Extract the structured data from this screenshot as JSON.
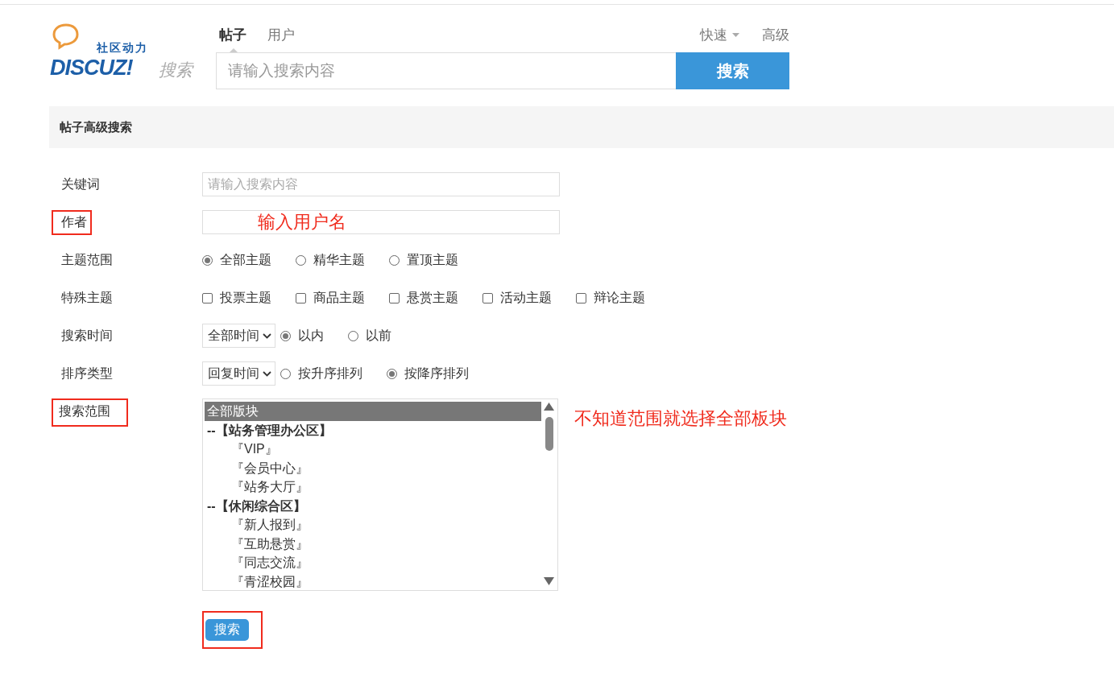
{
  "header": {
    "logo": {
      "tagline": "社区动力",
      "brand": "DISCUZ!",
      "suffix": "搜索"
    },
    "tabs": [
      {
        "label": "帖子",
        "selected": true
      },
      {
        "label": "用户",
        "selected": false
      }
    ],
    "links": [
      {
        "label": "快速",
        "kind": "dropdown"
      },
      {
        "label": "高级",
        "kind": "plain"
      }
    ],
    "search": {
      "placeholder": "请输入搜索内容",
      "button": "搜索"
    }
  },
  "panel": {
    "title": "帖子高级搜索"
  },
  "form": {
    "rows": [
      {
        "kind": "text",
        "label": "关键词",
        "placeholder": "请输入搜索内容",
        "highlighted": false
      },
      {
        "kind": "text",
        "label": "作者",
        "highlighted": true,
        "note": "输入用户名"
      },
      {
        "kind": "radio",
        "label": "主题范围",
        "highlighted": false,
        "options": [
          {
            "label": "全部主题",
            "selected": true
          },
          {
            "label": "精华主题",
            "selected": false
          },
          {
            "label": "置顶主题",
            "selected": false
          }
        ]
      },
      {
        "kind": "checkbox",
        "label": "特殊主题",
        "highlighted": false,
        "options": [
          {
            "label": "投票主题",
            "checked": false
          },
          {
            "label": "商品主题",
            "checked": false
          },
          {
            "label": "悬赏主题",
            "checked": false
          },
          {
            "label": "活动主题",
            "checked": false
          },
          {
            "label": "辩论主题",
            "checked": false
          }
        ]
      },
      {
        "kind": "select_radio",
        "label": "搜索时间",
        "highlighted": false,
        "select": "全部时间",
        "options": [
          {
            "label": "以内",
            "selected": true
          },
          {
            "label": "以前",
            "selected": false
          }
        ]
      },
      {
        "kind": "select_radio",
        "label": "排序类型",
        "highlighted": false,
        "select": "回复时间",
        "options": [
          {
            "label": "按升序排列",
            "selected": false
          },
          {
            "label": "按降序排列",
            "selected": true
          }
        ]
      },
      {
        "kind": "list",
        "label": "搜索范围",
        "highlighted": true,
        "note": "不知道范围就选择全部板块",
        "items": [
          {
            "label": "全部版块",
            "kind": "all",
            "selected": true
          },
          {
            "label": "--【站务管理办公区】",
            "kind": "group",
            "selected": false
          },
          {
            "label": "『VIP』",
            "kind": "forum",
            "selected": false
          },
          {
            "label": "『会员中心』",
            "kind": "forum",
            "selected": false
          },
          {
            "label": "『站务大厅』",
            "kind": "forum",
            "selected": false
          },
          {
            "label": "--【休闲综合区】",
            "kind": "group",
            "selected": false
          },
          {
            "label": "『新人报到』",
            "kind": "forum",
            "selected": false
          },
          {
            "label": "『互助悬赏』",
            "kind": "forum",
            "selected": false
          },
          {
            "label": "『同志交流』",
            "kind": "forum",
            "selected": false
          },
          {
            "label": "『青涩校园』",
            "kind": "forum",
            "selected": false
          }
        ]
      }
    ],
    "submit": {
      "label": "搜索",
      "highlighted": true
    }
  }
}
